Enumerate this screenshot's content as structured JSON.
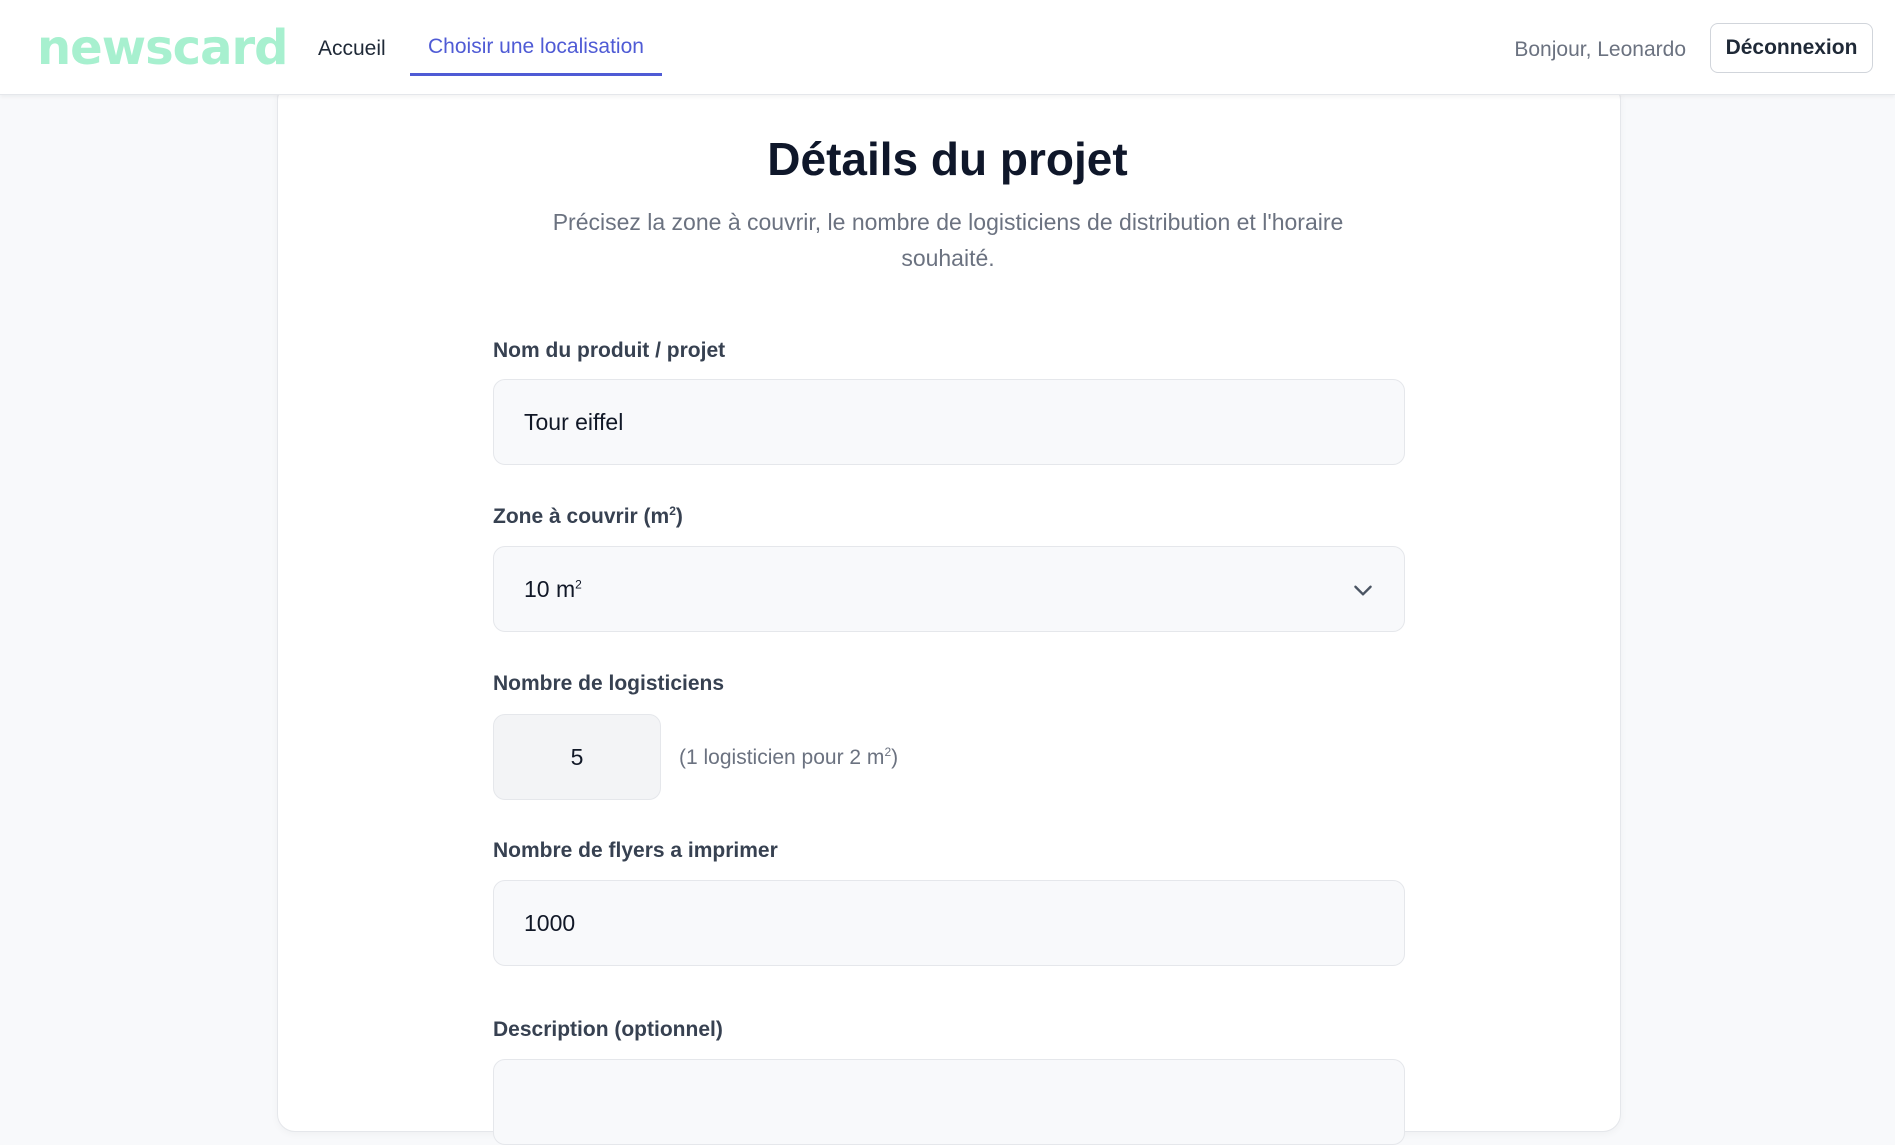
{
  "header": {
    "logo": "newscard",
    "nav": {
      "home": "Accueil",
      "choose_location": "Choisir une localisation"
    },
    "greeting": "Bonjour, Leonardo",
    "logout_label": "Déconnexion"
  },
  "page": {
    "title": "Détails du projet",
    "subtitle": "Précisez la zone à couvrir, le nombre de logisticiens de distribution et l'horaire souhaité."
  },
  "form": {
    "product_name": {
      "label": "Nom du produit / projet",
      "value": "Tour eiffel"
    },
    "zone": {
      "label_main": "Zone à couvrir (m",
      "label_sup": "2",
      "label_end": ")",
      "selected_main": "10 m",
      "selected_sup": "2"
    },
    "logisticians": {
      "label": "Nombre de logisticiens",
      "value": "5",
      "hint_main": "(1 logisticien pour 2 m",
      "hint_sup": "2",
      "hint_end": ")"
    },
    "flyers": {
      "label": "Nombre de flyers a imprimer",
      "value": "1000"
    },
    "description": {
      "label": "Description (optionnel)"
    }
  },
  "colors": {
    "accent": "#4f5bd5",
    "logo": "#a7f0cf",
    "background": "#f8f9fb"
  }
}
